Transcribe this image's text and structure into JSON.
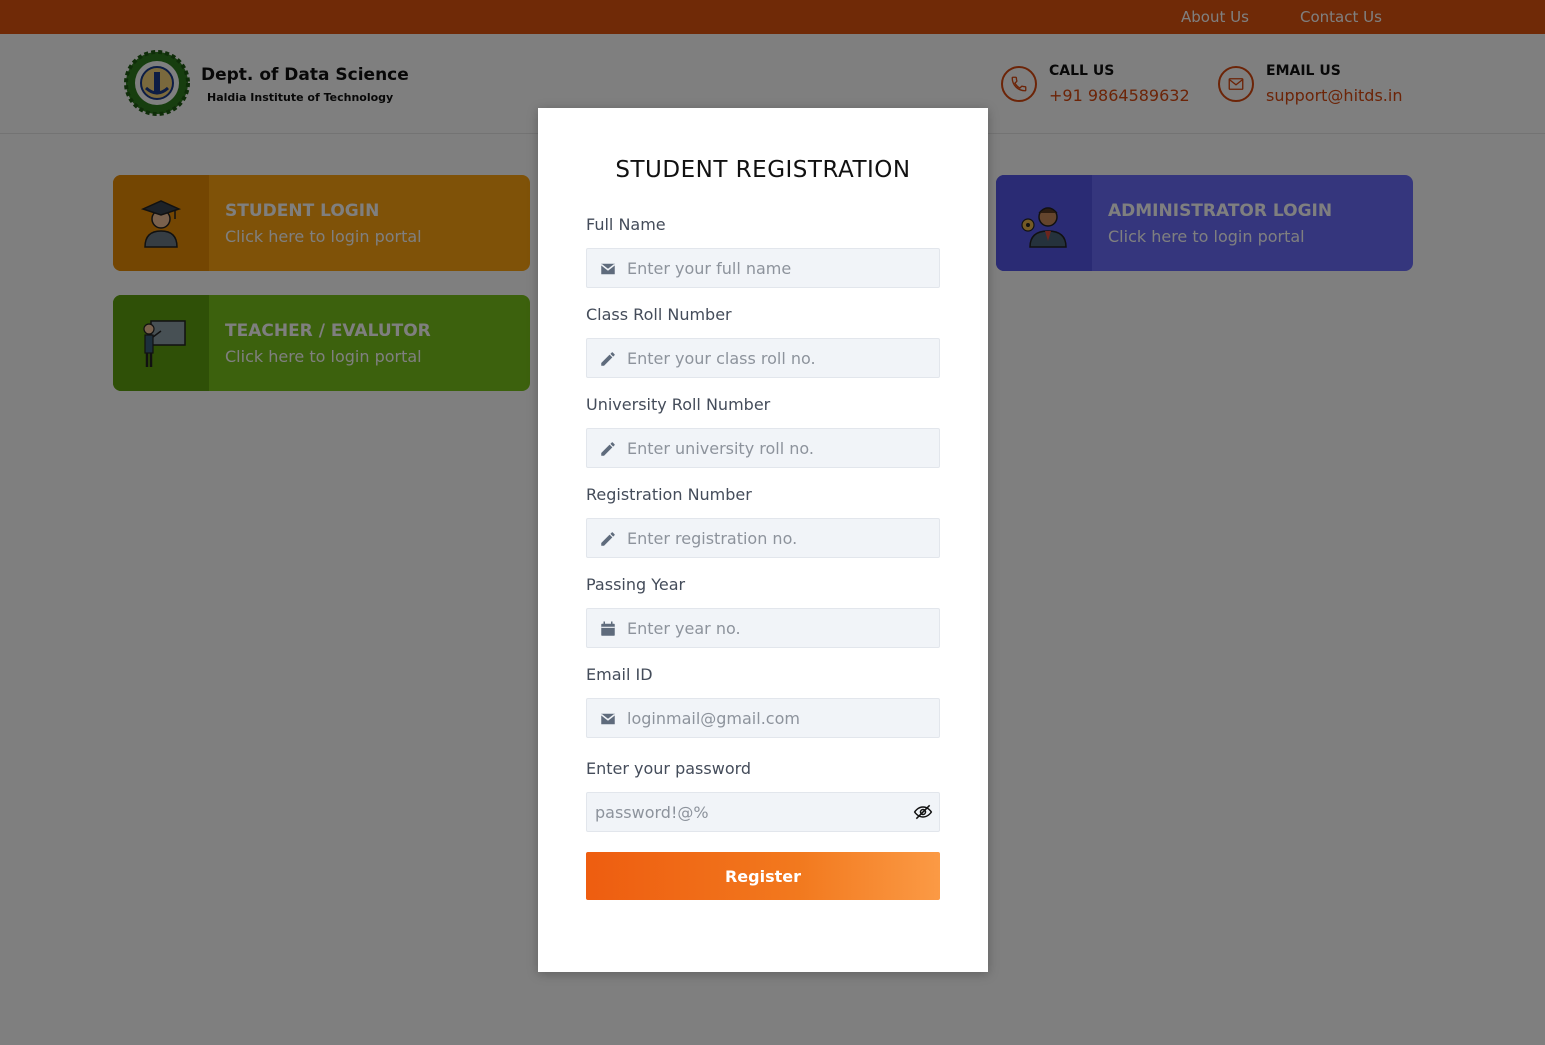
{
  "topnav": {
    "about": "About Us",
    "contact": "Contact Us"
  },
  "brand": {
    "title": "Dept. of Data Science",
    "subtitle": "Haldia Institute of Technology"
  },
  "contact": {
    "call_label": "CALL US",
    "call_value": "+91 9864589632",
    "email_label": "EMAIL US",
    "email_value": "support@hitds.in"
  },
  "tiles": {
    "student": {
      "title": "STUDENT LOGIN",
      "sub": "Click here to login portal"
    },
    "teacher": {
      "title": "TEACHER / EVALUTOR",
      "sub": "Click here to login portal"
    },
    "admin": {
      "title": "ADMINISTRATOR LOGIN",
      "sub": "Click here to login portal"
    }
  },
  "form": {
    "title": "STUDENT REGISTRATION",
    "fields": {
      "full_name": {
        "label": "Full Name",
        "placeholder": "Enter your full name",
        "icon": "envelope-icon"
      },
      "class_roll": {
        "label": "Class Roll Number",
        "placeholder": "Enter your class roll no.",
        "icon": "pencil-icon"
      },
      "university_roll": {
        "label": "University Roll Number",
        "placeholder": "Enter university roll no.",
        "icon": "pencil-icon"
      },
      "registration": {
        "label": "Registration Number",
        "placeholder": "Enter registration no.",
        "icon": "pencil-icon"
      },
      "passing_year": {
        "label": "Passing Year",
        "placeholder": "Enter year no.",
        "icon": "calendar-icon"
      },
      "email": {
        "label": "Email ID",
        "placeholder": "loginmail@gmail.com",
        "icon": "envelope-icon"
      },
      "password": {
        "label": "Enter your password",
        "placeholder": "password!@%",
        "icon": "eye-off-icon"
      }
    },
    "submit": "Register"
  },
  "colors": {
    "accent": "#e0540f",
    "student_tile": "#ffa510",
    "teacher_tile": "#79c21a",
    "admin_tile": "#6b6dfa",
    "register_gradient_start": "#ee5d10",
    "register_gradient_end": "#fb9a45"
  }
}
